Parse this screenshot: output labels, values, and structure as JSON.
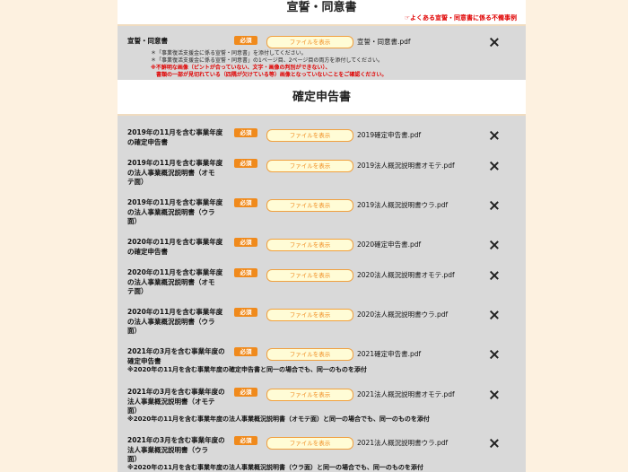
{
  "section1": {
    "title": "宣誓・同意書",
    "faq_link_icon": "pointing-hand-icon",
    "faq_link_text": "よくある宣誓・同意書に係る不備事例",
    "row": {
      "label": "宣誓・同意書",
      "required": "必須",
      "button": "ファイルを表示",
      "filename": "宣誓・同意書.pdf"
    },
    "notes": [
      "＊「事業復活支援金に係る宣誓・同意書」を添付してください。",
      "＊「事業復活支援金に係る宣誓・同意書」の1ページ目、2ページ目の両方を添付してください。"
    ],
    "warnings": [
      "※不鮮明な画像（ピントが合っていない、文字・画像の判別ができない）、",
      "　書類の一部が見切れている（四隅が欠けている等）画像となっていないことをご確認ください。"
    ]
  },
  "section2": {
    "title": "確定申告書",
    "rows": [
      {
        "label1": "2019年の11月を含む事業年度",
        "label2": "の確定申告書",
        "label3": "",
        "required": "必須",
        "button": "ファイルを表示",
        "filename": "2019確定申告書.pdf",
        "note": ""
      },
      {
        "label1": "2019年の11月を含む事業年度",
        "label2": "の法人事業概況説明書（オモ",
        "label3": "テ面）",
        "required": "必須",
        "button": "ファイルを表示",
        "filename": "2019法人概況説明書オモテ.pdf",
        "note": ""
      },
      {
        "label1": "2019年の11月を含む事業年度",
        "label2": "の法人事業概況説明書（ウラ",
        "label3": "面）",
        "required": "必須",
        "button": "ファイルを表示",
        "filename": "2019法人概況説明書ウラ.pdf",
        "note": ""
      },
      {
        "label1": "2020年の11月を含む事業年度",
        "label2": "の確定申告書",
        "label3": "",
        "required": "必須",
        "button": "ファイルを表示",
        "filename": "2020確定申告書.pdf",
        "note": ""
      },
      {
        "label1": "2020年の11月を含む事業年度",
        "label2": "の法人事業概況説明書（オモ",
        "label3": "テ面）",
        "required": "必須",
        "button": "ファイルを表示",
        "filename": "2020法人概況説明書オモテ.pdf",
        "note": ""
      },
      {
        "label1": "2020年の11月を含む事業年度",
        "label2": "の法人事業概況説明書（ウラ",
        "label3": "面）",
        "required": "必須",
        "button": "ファイルを表示",
        "filename": "2020法人概況説明書ウラ.pdf",
        "note": ""
      },
      {
        "label1": "2021年の3月を含む事業年度の",
        "label2": "確定申告書",
        "label3": "",
        "required": "必須",
        "button": "ファイルを表示",
        "filename": "2021確定申告書.pdf",
        "note": "※2020年の11月を含む事業年度の確定申告書と同一の場合でも、同一のものを添付"
      },
      {
        "label1": "2021年の3月を含む事業年度の",
        "label2": "法人事業概況説明書（オモテ",
        "label3": "面）",
        "required": "必須",
        "button": "ファイルを表示",
        "filename": "2021法人概況説明書オモテ.pdf",
        "note": "※2020年の11月を含む事業年度の法人事業概況説明書（オモテ面）と同一の場合でも、同一のものを添付"
      },
      {
        "label1": "2021年の3月を含む事業年度の",
        "label2": "法人事業概況説明書（ウラ",
        "label3": "面）",
        "required": "必須",
        "button": "ファイルを表示",
        "filename": "2021法人概況説明書ウラ.pdf",
        "note": "※2020年の11月を含む事業年度の法人事業概況説明書（ウラ面）と同一の場合でも、同一のものを添付"
      }
    ]
  }
}
